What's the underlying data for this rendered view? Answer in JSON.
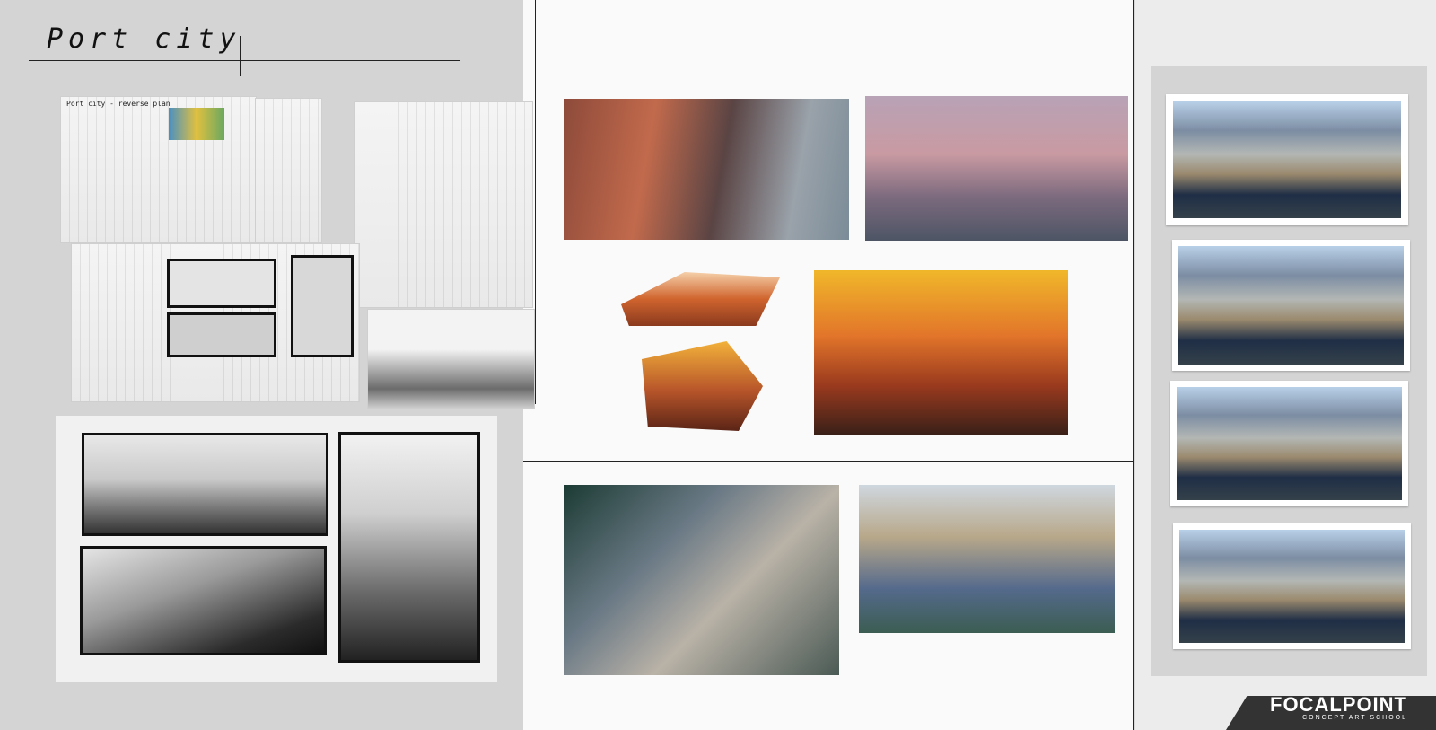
{
  "board": {
    "title": "Port city",
    "sketch_note": "Port city - reverse plan",
    "brand": {
      "name": "FOCALPOINT",
      "tagline": "CONCEPT ART SCHOOL"
    }
  },
  "colors": {
    "background": "#d7d7d7",
    "sheet": "#fbfbfb",
    "brand_bar": "#333333"
  },
  "sections": {
    "left": [
      "sketch-sheet-1",
      "sketch-sheet-2",
      "thumbnail-sheet",
      "value-studies"
    ],
    "middle": [
      "color-studies-top",
      "aerial-renders"
    ],
    "right": [
      "mountain-port-iterations"
    ]
  }
}
